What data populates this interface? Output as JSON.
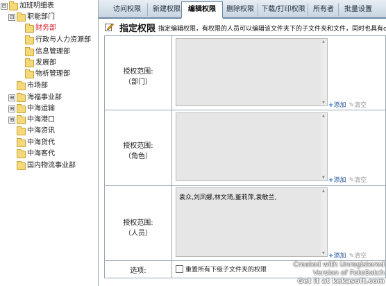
{
  "tree": {
    "items": [
      {
        "expander": "⊟",
        "label": "加班明细表",
        "red": false
      },
      {
        "expander": "⊟",
        "label": "职能部门",
        "red": false
      },
      {
        "expander": "",
        "label": "财务部",
        "red": true
      },
      {
        "expander": "",
        "label": "行政与人力资源部",
        "red": false
      },
      {
        "expander": "",
        "label": "信息管理部",
        "red": false
      },
      {
        "expander": "",
        "label": "发展部",
        "red": false
      },
      {
        "expander": "",
        "label": "物析管理部",
        "red": false
      },
      {
        "expander": "",
        "label": "市场部",
        "red": false
      },
      {
        "expander": "⊞",
        "label": "海福事业部",
        "red": false
      },
      {
        "expander": "⊞",
        "label": "中海运输",
        "red": false
      },
      {
        "expander": "⊞",
        "label": "中海港口",
        "red": false
      },
      {
        "expander": "",
        "label": "中海资讯",
        "red": false
      },
      {
        "expander": "",
        "label": "中海货代",
        "red": false
      },
      {
        "expander": "",
        "label": "中海客代",
        "red": false
      },
      {
        "expander": "",
        "label": "国内物流事业部",
        "red": false
      }
    ]
  },
  "tabs": [
    "访问权限",
    "新建权限",
    "编辑权限",
    "删除权限",
    "下载/打印权限",
    "所有者",
    "批量设置"
  ],
  "active_tab": "编辑权限",
  "header": {
    "title": "指定权限",
    "description": "指定编辑权限，有权限的人员可以编辑该文件夹下的子文件夹和文件，同时也具有ofi"
  },
  "rows": [
    {
      "label_line1": "授权范围:",
      "label_line2": "（部门）",
      "content": "",
      "add": "添加",
      "clear": "清空"
    },
    {
      "label_line1": "授权范围:",
      "label_line2": "（角色）",
      "content": "",
      "add": "添加",
      "clear": "清空"
    },
    {
      "label_line1": "授权范围:",
      "label_line2": "（人员）",
      "content": "袁众,刘凤娜,林文琦,董莉萍,袁敏兰,",
      "add": "添加",
      "clear": "清空"
    }
  ],
  "options": {
    "label": "选项:",
    "checkbox_label": "重置所有下级子文件夹的权限",
    "checked": false
  },
  "watermark": {
    "line1": "Created with Unregistered",
    "line2": "Version of FotoBatch",
    "line3": "Get it at kekasoft.com"
  }
}
